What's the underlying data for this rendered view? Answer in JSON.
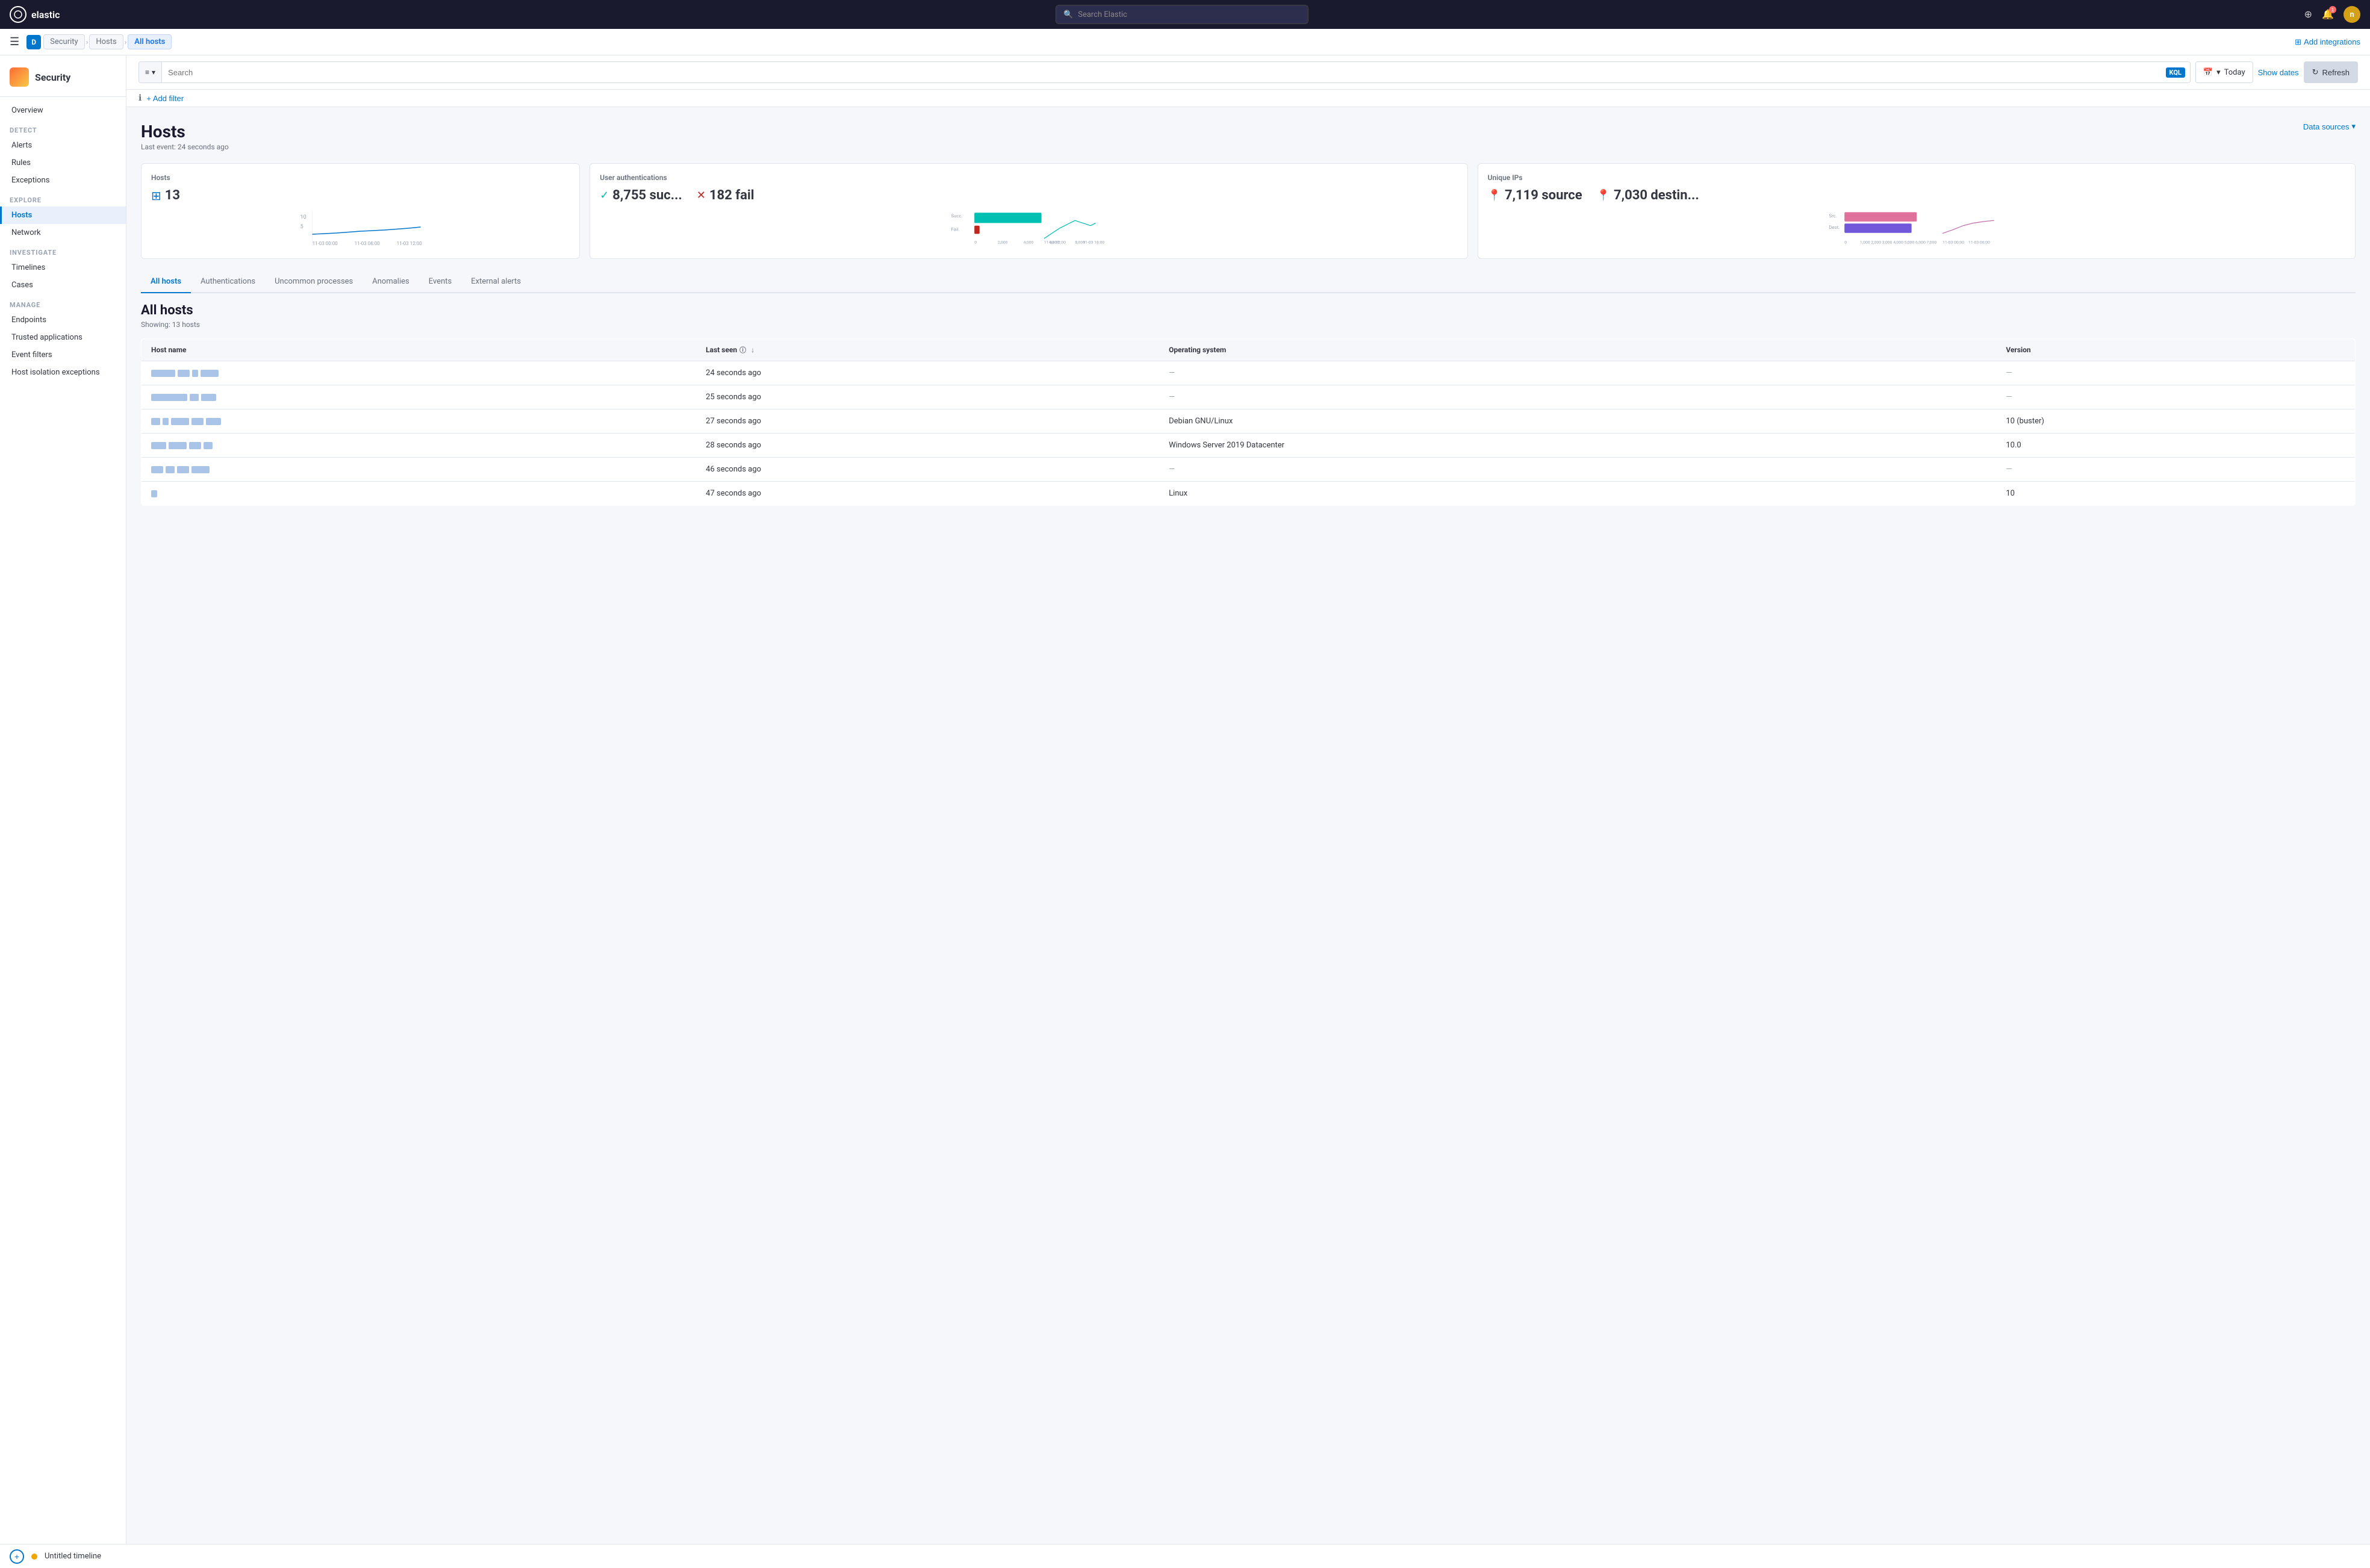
{
  "top_nav": {
    "logo_text": "elastic",
    "search_placeholder": "Search Elastic",
    "user_initials": "n",
    "notification_count": "1"
  },
  "breadcrumb": {
    "d_label": "D",
    "security_label": "Security",
    "hosts_label": "Hosts",
    "all_hosts_label": "All hosts",
    "add_integrations": "Add integrations"
  },
  "sidebar": {
    "title": "Security",
    "overview_label": "Overview",
    "detect_label": "Detect",
    "alerts_label": "Alerts",
    "rules_label": "Rules",
    "exceptions_label": "Exceptions",
    "explore_label": "Explore",
    "hosts_label": "Hosts",
    "network_label": "Network",
    "investigate_label": "Investigate",
    "timelines_label": "Timelines",
    "cases_label": "Cases",
    "manage_label": "Manage",
    "endpoints_label": "Endpoints",
    "trusted_apps_label": "Trusted applications",
    "event_filters_label": "Event filters",
    "host_isolation_label": "Host isolation exceptions"
  },
  "toolbar": {
    "search_placeholder": "Search",
    "kql_label": "KQL",
    "date_label": "Today",
    "show_dates_label": "Show dates",
    "refresh_label": "Refresh"
  },
  "filter_row": {
    "add_filter_label": "+ Add filter"
  },
  "page": {
    "title": "Hosts",
    "last_event": "Last event: 24 seconds ago",
    "data_sources_label": "Data sources"
  },
  "stats": {
    "hosts_card": {
      "title": "Hosts",
      "count": "13"
    },
    "auth_card": {
      "title": "User authentications",
      "success_count": "8,755 suc...",
      "fail_count": "182 fail"
    },
    "ips_card": {
      "title": "Unique IPs",
      "source_count": "7,119 source",
      "dest_count": "7,030 destin..."
    }
  },
  "tabs": [
    {
      "label": "All hosts",
      "active": true
    },
    {
      "label": "Authentications",
      "active": false
    },
    {
      "label": "Uncommon processes",
      "active": false
    },
    {
      "label": "Anomalies",
      "active": false
    },
    {
      "label": "Events",
      "active": false
    },
    {
      "label": "External alerts",
      "active": false
    }
  ],
  "table": {
    "title": "All hosts",
    "subtitle": "Showing: 13 hosts",
    "columns": [
      "Host name",
      "Last seen",
      "Operating system",
      "Version"
    ],
    "rows": [
      {
        "hostname_widths": [
          40,
          20,
          10,
          30
        ],
        "last_seen": "24 seconds ago",
        "os": "—",
        "version": "—"
      },
      {
        "hostname_widths": [
          60,
          15,
          25
        ],
        "last_seen": "25 seconds ago",
        "os": "—",
        "version": "—"
      },
      {
        "hostname_widths": [
          15,
          10,
          30,
          20,
          25
        ],
        "last_seen": "27 seconds ago",
        "os": "Debian GNU/Linux",
        "version": "10 (buster)"
      },
      {
        "hostname_widths": [
          25,
          30,
          20,
          15
        ],
        "last_seen": "28 seconds ago",
        "os": "Windows Server 2019 Datacenter",
        "version": "10.0"
      },
      {
        "hostname_widths": [
          20,
          15,
          20,
          30
        ],
        "last_seen": "46 seconds ago",
        "os": "—",
        "version": "—"
      },
      {
        "hostname_widths": [
          10
        ],
        "last_seen": "47 seconds ago",
        "os": "Linux",
        "version": "10"
      }
    ]
  },
  "bottom_bar": {
    "timeline_label": "Untitled timeline"
  }
}
